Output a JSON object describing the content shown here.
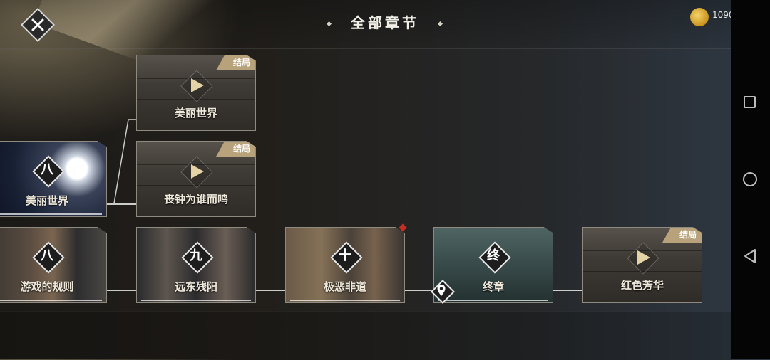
{
  "header": {
    "title": "全部章节",
    "coins": "1090"
  },
  "colors": {
    "tag_bg": "#b8a27c",
    "red_marker": "#c62d22",
    "coin": "#e2b33a"
  },
  "icons": {
    "close": "close-icon",
    "coin": "coin-icon",
    "play": "play-icon",
    "pin": "location-pin-icon",
    "nav": [
      "recents-square-icon",
      "home-circle-icon",
      "back-triangle-icon"
    ]
  },
  "branch_cards": [
    {
      "tag": "结局",
      "label": "美丽世界"
    },
    {
      "tag": "结局",
      "label": "丧钟为谁而鸣"
    }
  ],
  "branch_chapter": {
    "num": "八",
    "label": "美丽世界"
  },
  "main_chapters": [
    {
      "num": "八",
      "label": "游戏的规则"
    },
    {
      "num": "九",
      "label": "远东残阳"
    },
    {
      "num": "十",
      "label": "极恶非道"
    },
    {
      "num": "终",
      "label": "终章"
    }
  ],
  "final_card": {
    "tag": "结局",
    "label": "红色芳华"
  }
}
